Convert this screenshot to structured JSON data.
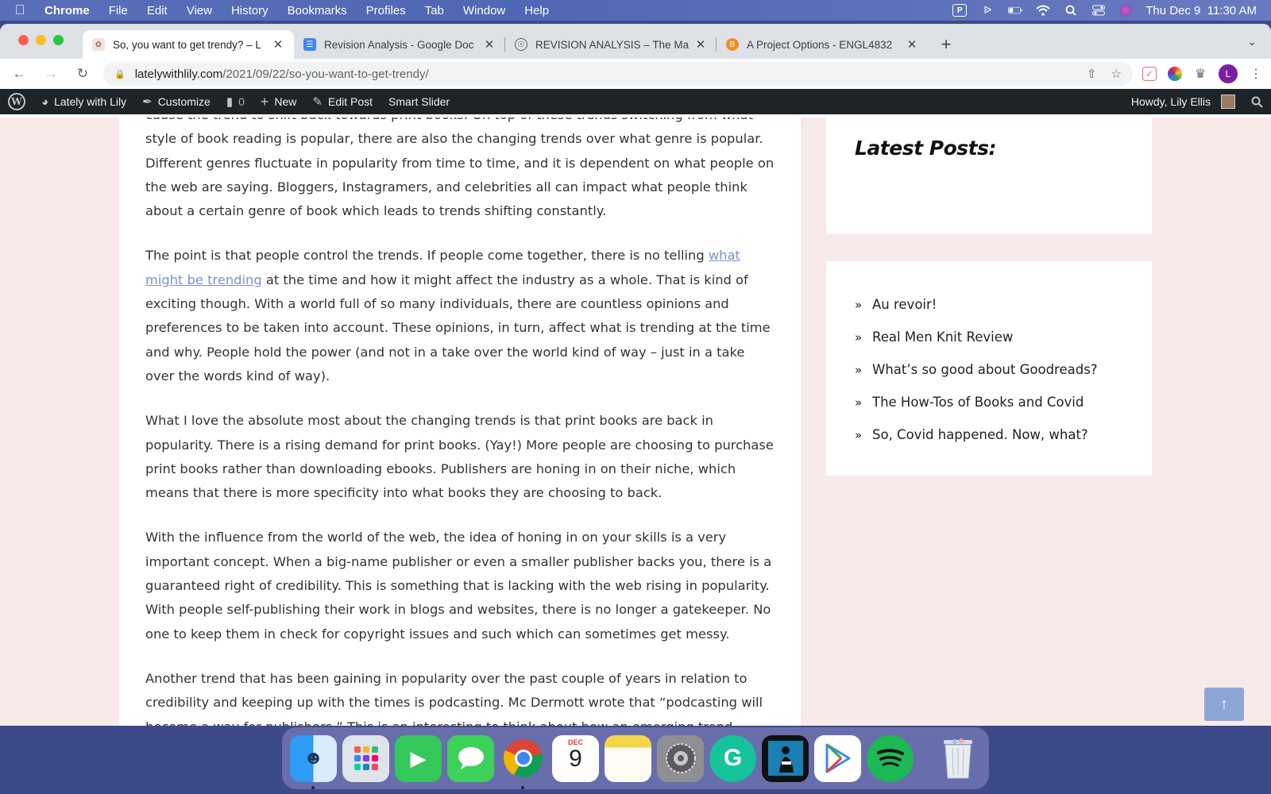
{
  "menubar": {
    "app_name": "Chrome",
    "menus": [
      "File",
      "Edit",
      "View",
      "History",
      "Bookmarks",
      "Profiles",
      "Tab",
      "Window",
      "Help"
    ],
    "clock": "Thu Dec 9  11:30 AM"
  },
  "tabs": [
    {
      "title": "So, you want to get trendy? – L",
      "active": true
    },
    {
      "title": "Revision Analysis - Google Doc",
      "active": false
    },
    {
      "title": "REVISION ANALYSIS – The Ma",
      "active": false
    },
    {
      "title": "A Project Options - ENGL4832",
      "active": false
    }
  ],
  "address": {
    "host": "latelywithlily.com",
    "path": "/2021/09/22/so-you-want-to-get-trendy/"
  },
  "profile_initial": "L",
  "wpbar": {
    "site_name": "Lately with Lily",
    "customize": "Customize",
    "comments": "0",
    "new": "New",
    "edit_post": "Edit Post",
    "smart_slider": "Smart Slider",
    "howdy": "Howdy, Lily Ellis"
  },
  "article": {
    "p0": "cause the trend to shift back towards print books. On top of these trends switching from what style of book reading is popular, there are also the changing trends over what genre is popular. Different genres fluctuate in popularity from time to time, and it is dependent on what people on the web are saying. Bloggers, Instagramers, and celebrities all can impact what people think about a certain genre of book which leads to trends shifting constantly.",
    "p1_a": "The point is that people control the trends. If people come together, there is no telling ",
    "p1_link": "what might be trending",
    "p1_b": " at the time and how it might affect the industry as a whole. That is kind of exciting though. With a world full of so many individuals, there are countless opinions and preferences to be taken into account. These opinions, in turn, affect what is trending at the time and why. People hold the power (and not in a take over the world kind of way – just in a take over the words kind of way).",
    "p2": "What I love the absolute most about the changing trends is that print books are back in popularity. There is a rising demand for print books. (Yay!) More people are choosing to purchase print books rather than downloading ebooks. Publishers are honing in on their niche, which means that there is more specificity into what books they are choosing to back.",
    "p3": "With the influence from the world of the web, the idea of honing in on your skills is a very important concept. When a big-name publisher or even a smaller publisher backs you, there is a guaranteed right of credibility. This is something that is lacking with the web rising in popularity. With people self-publishing their work in blogs and websites, there is no longer a gatekeeper. No one to keep them in check for copyright issues and such which can sometimes get messy.",
    "p4": "Another trend that has been gaining in popularity over the past couple of years in relation to credibility and keeping up with the times is podcasting. Mc Dermott wrote that “podcasting will become a way for publishers.” This is an interesting to think about how an emerging trend"
  },
  "sidebar": {
    "latest_title": "Latest Posts:",
    "posts": [
      "Au revoir!",
      "Real Men Knit Review",
      "What’s so good about Goodreads?",
      "The How-Tos of Books and Covid",
      "So, Covid happened. Now, what?"
    ]
  },
  "dock": {
    "calendar_month": "DEC",
    "calendar_day": "9"
  },
  "colors": {
    "link": "#7a93c9",
    "page_bg": "#f8eaea",
    "wp_bar": "#1d2327",
    "to_top": "#8ea6d6"
  }
}
